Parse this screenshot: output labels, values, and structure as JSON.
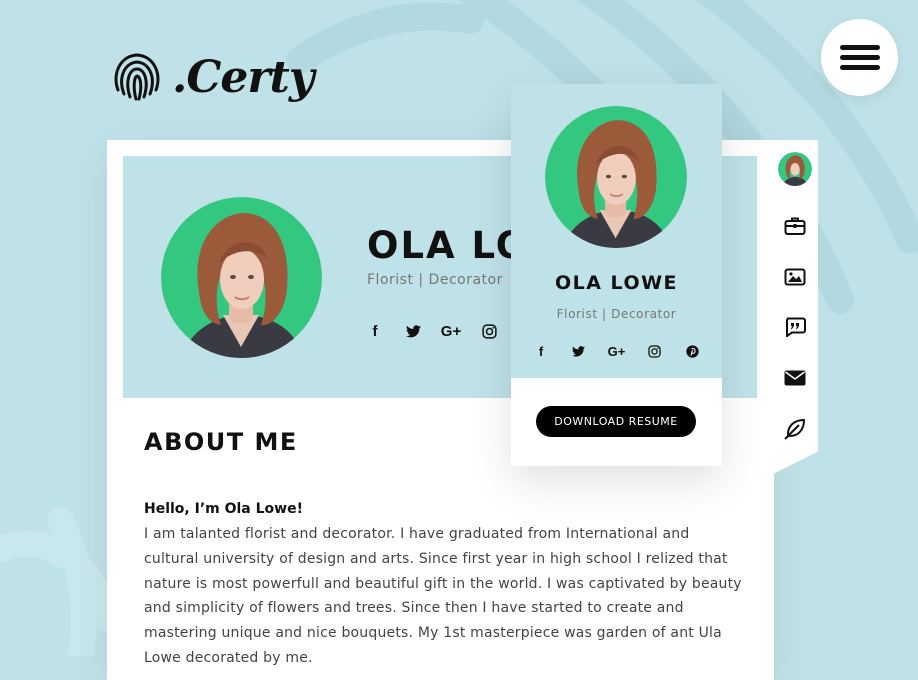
{
  "brand": {
    "logo_text": ".Certy"
  },
  "menu": {
    "icon": "hamburger-icon"
  },
  "profile": {
    "name": "OLA LOWE",
    "role": "Florist | Decorator",
    "socials": [
      {
        "name": "facebook-icon",
        "glyph": "f"
      },
      {
        "name": "twitter-icon",
        "glyph": "🐦"
      },
      {
        "name": "google-plus-icon",
        "glyph": "G+"
      },
      {
        "name": "instagram-icon",
        "glyph": "◎"
      }
    ]
  },
  "popup": {
    "name": "OLA LOWE",
    "role": "Florist | Decorator",
    "socials": [
      {
        "name": "facebook-icon",
        "glyph": "f"
      },
      {
        "name": "twitter-icon",
        "glyph": "🐦"
      },
      {
        "name": "google-plus-icon",
        "glyph": "G+"
      },
      {
        "name": "instagram-icon",
        "glyph": "◎"
      },
      {
        "name": "pinterest-icon",
        "glyph": "℗"
      }
    ],
    "download_label": "DOWNLOAD RESUME"
  },
  "about": {
    "title": "ABOUT ME",
    "greeting": "Hello, I’m Ola Lowe!",
    "bio_lines": [
      "I am talanted florist and decorator. I have graduated from International and",
      "cultural university of design and arts. Since first year in high school I relized that",
      "nature is most powerfull and beautiful gift in the world. I was captivated by beauty",
      "and simplicity of flowers and trees. Since then I have started to create and",
      "mastering unique and nice bouquets. My 1st masterpiece was garden of ant Ula",
      "Lowe decorated by me."
    ]
  },
  "sidenav": [
    {
      "name": "nav-avatar"
    },
    {
      "name": "briefcase-icon"
    },
    {
      "name": "portfolio-image-icon"
    },
    {
      "name": "quote-icon"
    },
    {
      "name": "envelope-icon"
    },
    {
      "name": "feather-icon"
    }
  ],
  "colors": {
    "accent_green": "#34c77f",
    "panel_blue": "#bfe2e8",
    "dark": "#111111"
  }
}
